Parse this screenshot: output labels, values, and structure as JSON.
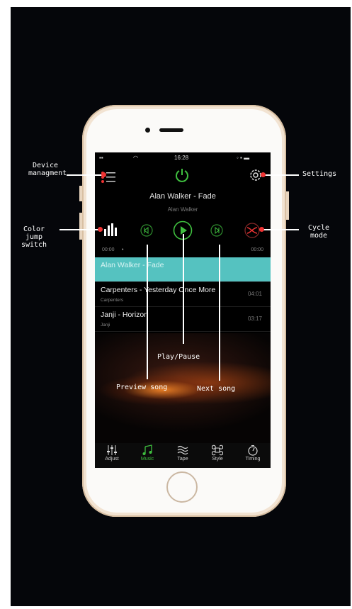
{
  "status": {
    "time": "16:28"
  },
  "now_playing": {
    "title": "Alan Walker - Fade",
    "artist": "Alan Walker"
  },
  "progress": {
    "elapsed": "00:00",
    "total": "00:00"
  },
  "playlist": [
    {
      "title": "Alan Walker - Fade",
      "artist": "",
      "duration": "",
      "active": true
    },
    {
      "title": "Carpenters - Yesterday Once More",
      "artist": "Carpenters",
      "duration": "04:01",
      "active": false
    },
    {
      "title": "Janji - Horizon",
      "artist": "Janji",
      "duration": "03:17",
      "active": false
    }
  ],
  "tabs": [
    {
      "label": "Adjust",
      "icon": "sliders-icon"
    },
    {
      "label": "Music",
      "icon": "music-note-icon"
    },
    {
      "label": "Tape",
      "icon": "wave-icon"
    },
    {
      "label": "Style",
      "icon": "command-icon"
    },
    {
      "label": "Timing",
      "icon": "timer-icon"
    }
  ],
  "annotations": {
    "device": [
      "Device",
      "managment"
    ],
    "settings": "Settings",
    "color": [
      "Color",
      "jump",
      "switch"
    ],
    "cycle": [
      "Cycle",
      "mode"
    ],
    "play_pause": "Play/Pause",
    "preview": "Preview song",
    "next": "Next song"
  },
  "colors": {
    "accent": "#3fbf3f",
    "highlight": "#55c2c0",
    "annotation_dot": "#e33333"
  }
}
